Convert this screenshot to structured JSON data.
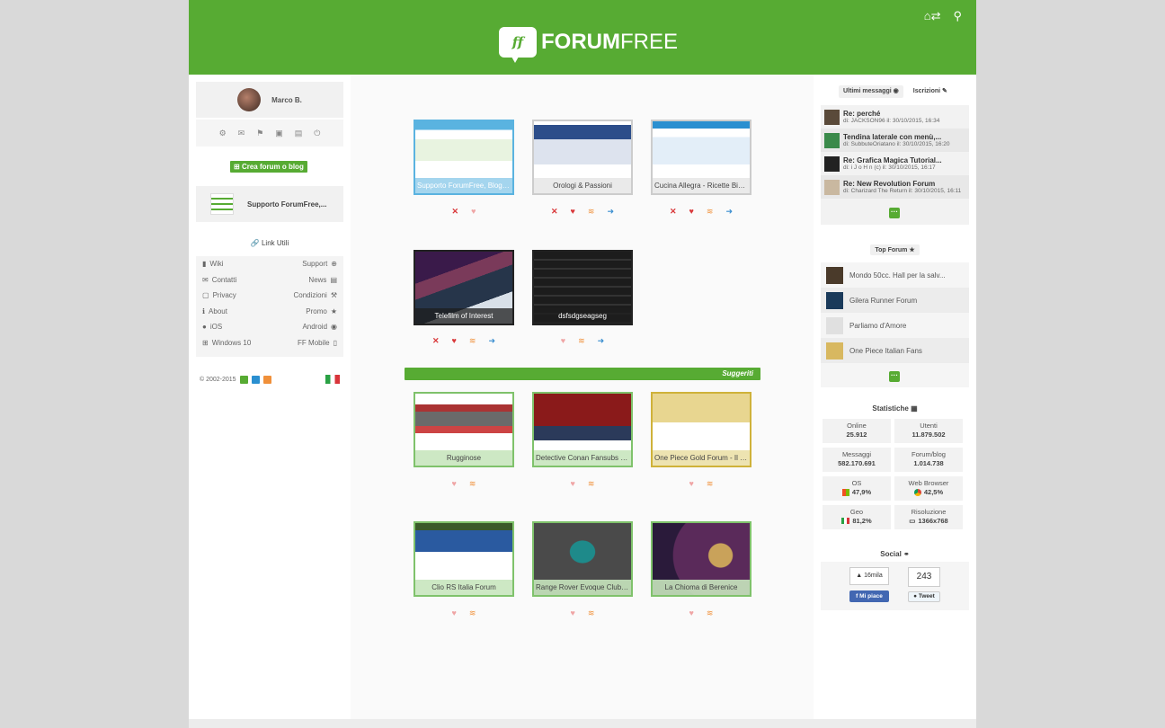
{
  "header": {
    "logo_mark": "ff",
    "logo_bold": "FORUM",
    "logo_light": "FREE"
  },
  "user": {
    "name": "Marco B."
  },
  "left": {
    "create_label": "Crea forum o blog",
    "support_forum": "Supporto ForumFree,...",
    "links_title": "Link Utili",
    "links": [
      [
        "Wiki",
        "Support"
      ],
      [
        "Contatti",
        "News"
      ],
      [
        "Privacy",
        "Condizioni"
      ],
      [
        "About",
        "Promo"
      ],
      [
        "iOS",
        "Android"
      ],
      [
        "Windows 10",
        "FF Mobile"
      ]
    ],
    "copyright": "© 2002-2015"
  },
  "my_forums": [
    "Supporto ForumFree, BlogFree",
    "Orologi & Passioni",
    "Cucina Allegra - Ricette Bimby",
    "Telefilm of Interest",
    "dsfsdgseagseg"
  ],
  "suggest_label": "Suggeriti",
  "suggested": [
    "Rugginose",
    "Detective Conan Fansubs Forum",
    "One Piece Gold Forum - Il forum",
    "Clio RS Italia Forum",
    "Range Rover Evoque Club - Italia",
    "La Chioma di Berenice"
  ],
  "right": {
    "tab_messages": "Ultimi messaggi",
    "tab_signups": "Iscrizioni",
    "messages": [
      {
        "title": "Re: perché",
        "sub": "di: JACKSON96 il: 30/10/2015, 16:34"
      },
      {
        "title": "Tendina laterale con menù,...",
        "sub": "di: SubbuteOriatano il: 30/10/2015, 16:20"
      },
      {
        "title": "Re: Grafica Magica Tutorial...",
        "sub": "di: i J o H n (c) il: 30/10/2015, 16:17"
      },
      {
        "title": "Re: New Revolution Forum",
        "sub": "di: Charizard The Return il: 30/10/2015, 16:11"
      }
    ],
    "top_title": "Top Forum",
    "top_forums": [
      "Mondo 50cc. Hall per la salv...",
      "Gilera Runner Forum",
      "Parliamo d'Amore",
      "One Piece Italian Fans"
    ],
    "stats_title": "Statistiche",
    "stats": [
      {
        "label": "Online",
        "value": "25.912"
      },
      {
        "label": "Utenti",
        "value": "11.879.502"
      },
      {
        "label": "Messaggi",
        "value": "582.170.691"
      },
      {
        "label": "Forum/blog",
        "value": "1.014.738"
      },
      {
        "label": "OS",
        "value": "47,9%"
      },
      {
        "label": "Web Browser",
        "value": "42,5%"
      },
      {
        "label": "Geo",
        "value": "81,2%"
      },
      {
        "label": "Risoluzione",
        "value": "1366x768"
      }
    ],
    "social_title": "Social",
    "likes": "16mila",
    "like_btn": "Mi piace",
    "tweets": "243",
    "tweet_btn": "Tweet"
  },
  "more_glyph": "···"
}
